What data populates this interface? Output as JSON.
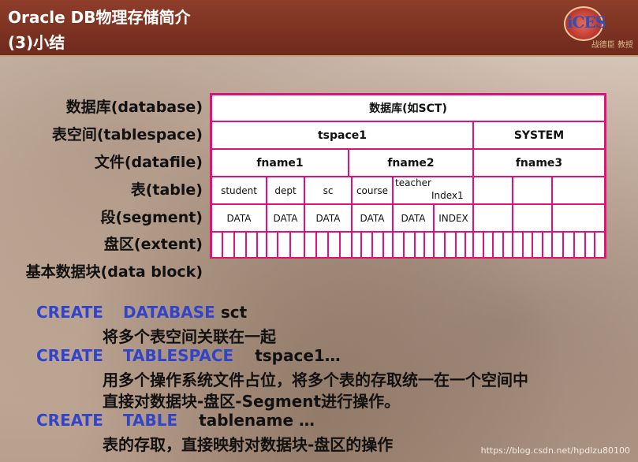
{
  "header": {
    "title_line1": "Oracle DB物理存储简介",
    "title_line2": "(3)小结",
    "logo_text": "iCES",
    "logo_name": "战德臣 教授"
  },
  "labels": [
    "数据库(database)",
    "表空间(tablespace)",
    "文件(datafile)",
    "表(table)",
    "段(segment)",
    "盘区(extent)",
    "基本数据块(data block)"
  ],
  "grid": {
    "database": "数据库(如SCT)",
    "tablespaces": [
      "tspace1",
      "SYSTEM"
    ],
    "files": [
      "fname1",
      "fname2",
      "fname3"
    ],
    "tables": [
      "student",
      "dept",
      "sc",
      "course",
      "teacher",
      "Index1"
    ],
    "segments": [
      "DATA",
      "DATA",
      "DATA",
      "DATA",
      "DATA",
      "INDEX"
    ]
  },
  "statements": [
    {
      "kw1": "CREATE",
      "kw2": "DATABASE",
      "arg": "sct",
      "desc": [
        "将多个表空间关联在一起"
      ]
    },
    {
      "kw1": "CREATE",
      "kw2": "TABLESPACE",
      "arg": "tspace1…",
      "desc": [
        "用多个操作系统文件占位，将多个表的存取统一在一个空间中",
        "直接对数据块-盘区-Segment进行操作。"
      ]
    },
    {
      "kw1": "CREATE",
      "kw2": "TABLE",
      "arg": "tablename …",
      "desc": [
        "表的存取，直接映射对数据块-盘区的操作"
      ]
    }
  ],
  "watermark": "https://blog.csdn.net/hpdlzu80100"
}
